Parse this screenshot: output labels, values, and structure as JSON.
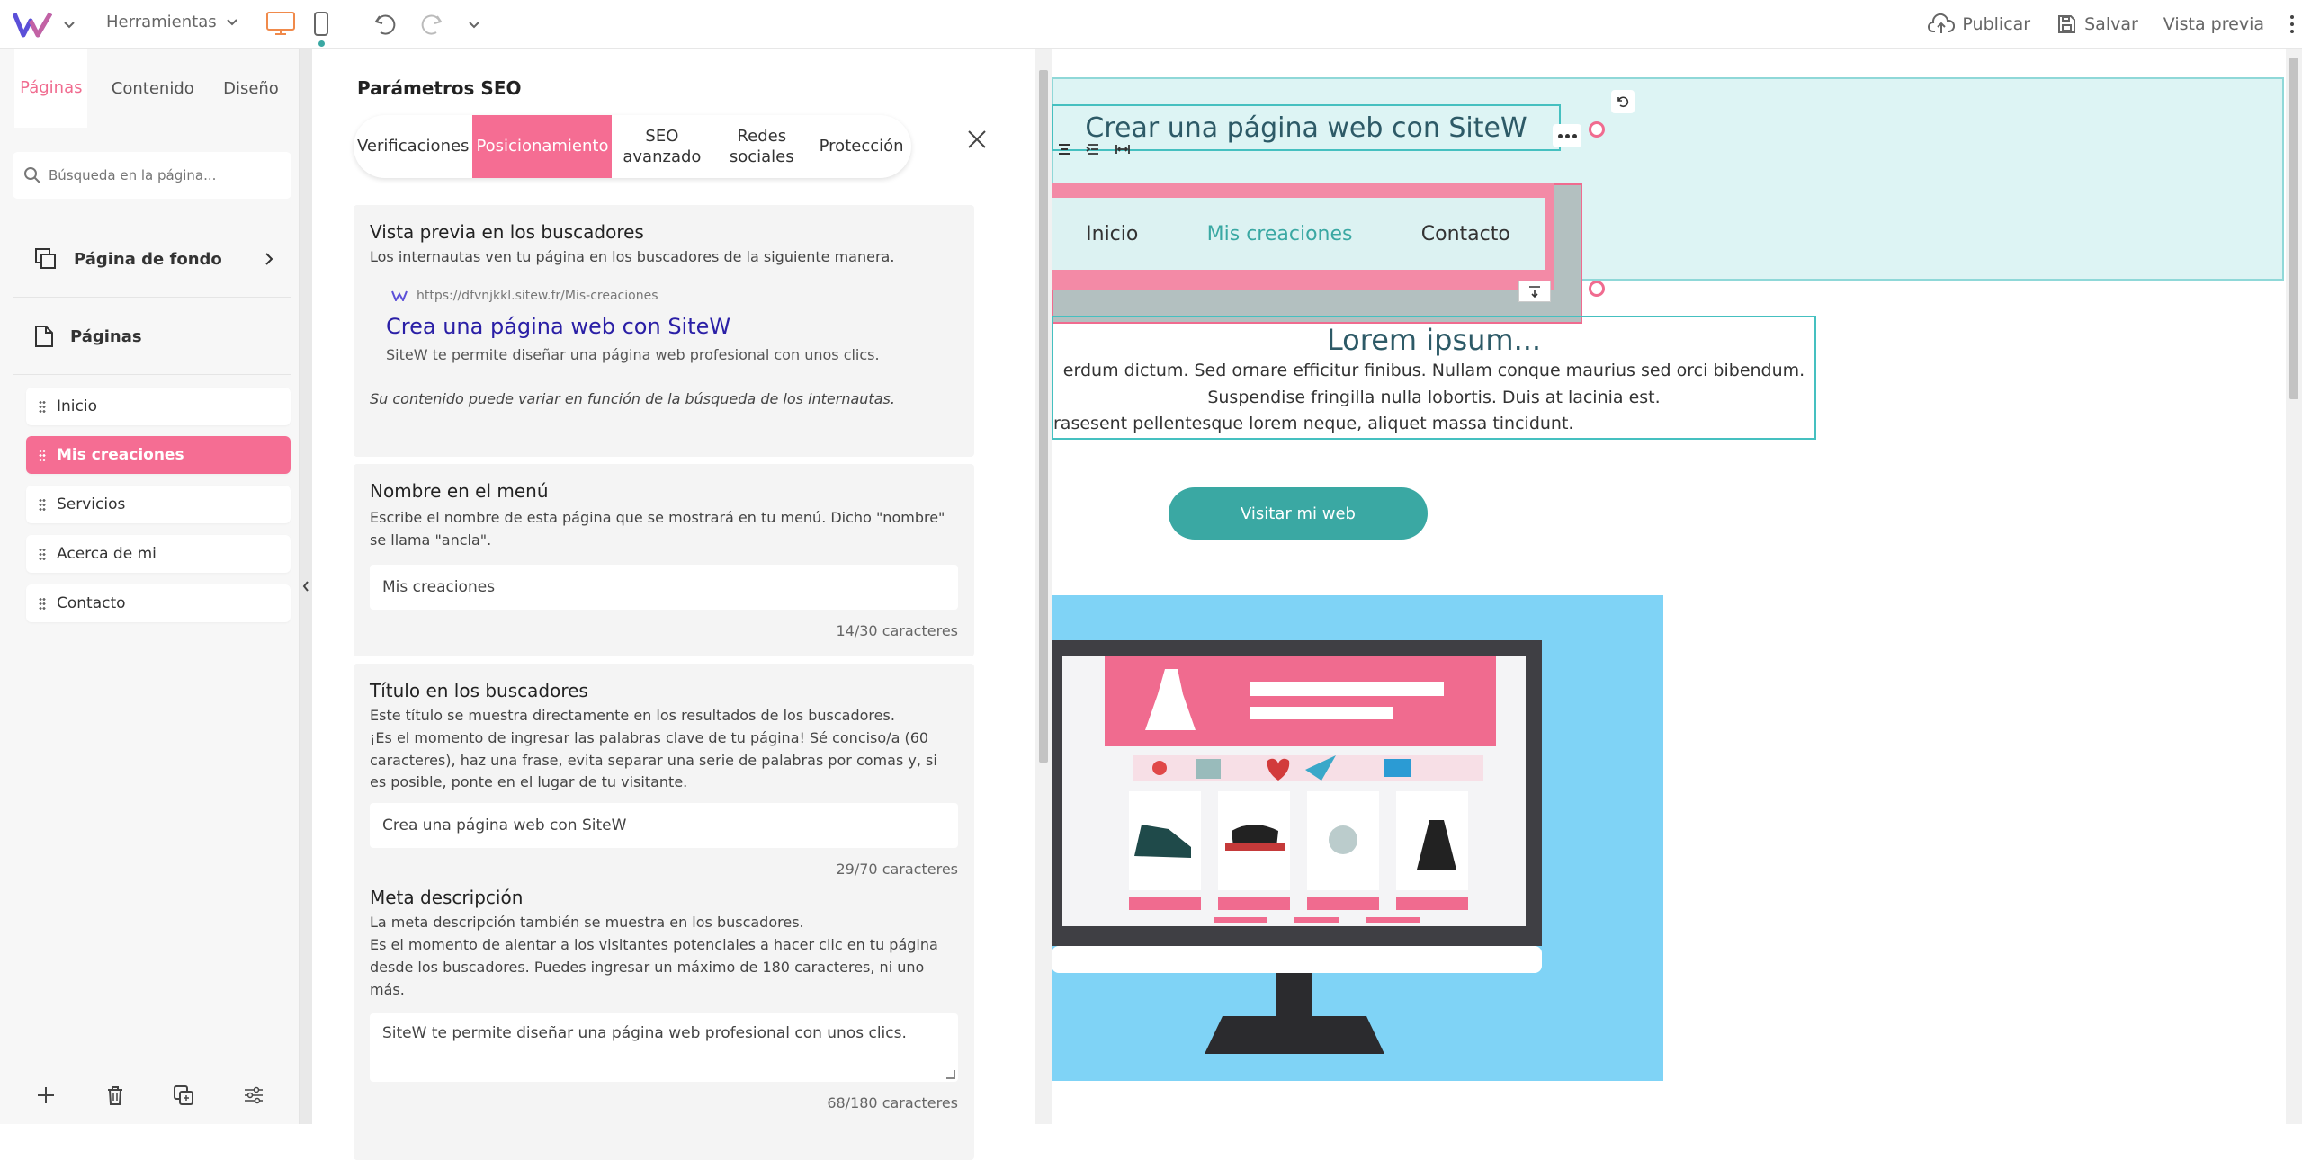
{
  "topbar": {
    "tools_label": "Herramientas",
    "publish_label": "Publicar",
    "save_label": "Salvar",
    "preview_label": "Vista previa",
    "colors": {
      "accent": "#f06b8f",
      "teal": "#3aa8a3"
    }
  },
  "left": {
    "tabs": [
      {
        "label": "Páginas"
      },
      {
        "label": "Contenido"
      },
      {
        "label": "Diseño"
      }
    ],
    "search_placeholder": "Búsqueda en la página...",
    "background_label": "Página de fondo",
    "pages_label": "Páginas",
    "pages": [
      {
        "label": "Inicio"
      },
      {
        "label": "Mis creaciones"
      },
      {
        "label": "Servicios"
      },
      {
        "label": "Acerca de mi"
      },
      {
        "label": "Contacto"
      }
    ]
  },
  "seo": {
    "title": "Parámetros SEO",
    "tabs": [
      {
        "label": "Verificaciones"
      },
      {
        "label": "Posicionamiento"
      },
      {
        "label": "SEO avanzado"
      },
      {
        "label": "Redes sociales"
      },
      {
        "label": "Protección"
      }
    ],
    "preview": {
      "heading": "Vista previa en los buscadores",
      "desc": "Los internautas ven tu página en los buscadores de la siguiente manera.",
      "url": "https://dfvnjkkl.sitew.fr/Mis-creaciones",
      "result_title": "Crea una página web con SiteW",
      "result_desc": "SiteW te permite diseñar una página web profesional con unos clics.",
      "note": "Su contenido puede variar en función de la búsqueda de los internautas."
    },
    "menu_name": {
      "heading": "Nombre en el menú",
      "desc": "Escribe el nombre de esta página que se mostrará en tu menú. Dicho \"nombre\" se llama \"ancla\".",
      "value": "Mis creaciones",
      "count": "14/30 caracteres"
    },
    "search_title": {
      "heading": "Título en los buscadores",
      "desc1": "Este título se muestra directamente en los resultados de los buscadores.",
      "desc2": "¡Es el momento de ingresar las palabras clave de tu página! Sé conciso/a (60 caracteres), haz una frase, evita separar una serie de palabras por comas y, si es posible, ponte en el lugar de tu visitante.",
      "value": "Crea una página web con SiteW",
      "count": "29/70 caracteres"
    },
    "meta": {
      "heading": "Meta descripción",
      "desc1": "La meta descripción también se muestra en los buscadores.",
      "desc2": "Es el momento de alentar a los visitantes potenciales a hacer clic en tu página desde los buscadores. Puedes ingresar un máximo de 180 caracteres, ni uno más.",
      "value": "SiteW te permite diseñar una página web profesional  con unos clics.",
      "count": "68/180 caracteres"
    }
  },
  "canvas": {
    "site_title": "Crear una página web con SiteW",
    "menu": [
      {
        "label": "Inicio"
      },
      {
        "label": "Mis creaciones"
      },
      {
        "label": "Contacto"
      }
    ],
    "lorem_title": "Lorem ipsum...",
    "lorem_lines": [
      "erdum dictum. Sed ornare efficitur finibus. Nullam conque maurius sed orci bibendum.",
      "Suspendise fringilla nulla lobortis. Duis at lacinia est.",
      "rasesent pellentesque lorem neque, aliquet massa tincidunt."
    ],
    "cta_label": "Visitar mi web"
  }
}
